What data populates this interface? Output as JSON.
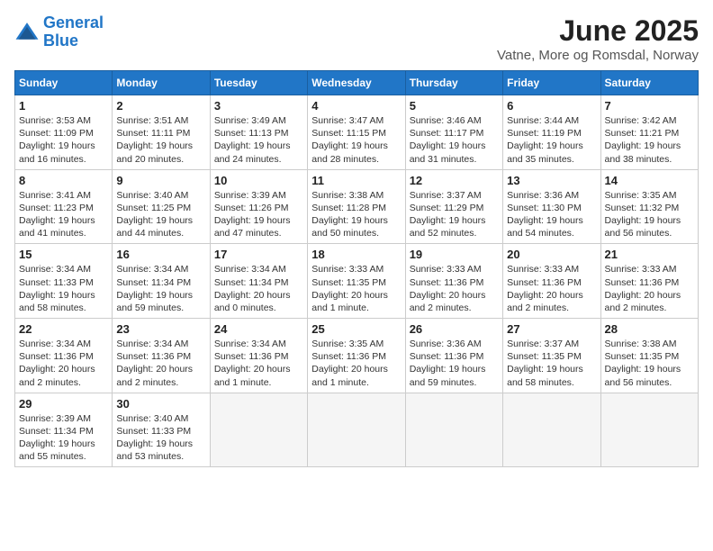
{
  "header": {
    "logo_line1": "General",
    "logo_line2": "Blue",
    "month_title": "June 2025",
    "location": "Vatne, More og Romsdal, Norway"
  },
  "weekdays": [
    "Sunday",
    "Monday",
    "Tuesday",
    "Wednesday",
    "Thursday",
    "Friday",
    "Saturday"
  ],
  "weeks": [
    [
      {
        "day": "1",
        "sunrise": "3:53 AM",
        "sunset": "11:09 PM",
        "daylight": "19 hours and 16 minutes."
      },
      {
        "day": "2",
        "sunrise": "3:51 AM",
        "sunset": "11:11 PM",
        "daylight": "19 hours and 20 minutes."
      },
      {
        "day": "3",
        "sunrise": "3:49 AM",
        "sunset": "11:13 PM",
        "daylight": "19 hours and 24 minutes."
      },
      {
        "day": "4",
        "sunrise": "3:47 AM",
        "sunset": "11:15 PM",
        "daylight": "19 hours and 28 minutes."
      },
      {
        "day": "5",
        "sunrise": "3:46 AM",
        "sunset": "11:17 PM",
        "daylight": "19 hours and 31 minutes."
      },
      {
        "day": "6",
        "sunrise": "3:44 AM",
        "sunset": "11:19 PM",
        "daylight": "19 hours and 35 minutes."
      },
      {
        "day": "7",
        "sunrise": "3:42 AM",
        "sunset": "11:21 PM",
        "daylight": "19 hours and 38 minutes."
      }
    ],
    [
      {
        "day": "8",
        "sunrise": "3:41 AM",
        "sunset": "11:23 PM",
        "daylight": "19 hours and 41 minutes."
      },
      {
        "day": "9",
        "sunrise": "3:40 AM",
        "sunset": "11:25 PM",
        "daylight": "19 hours and 44 minutes."
      },
      {
        "day": "10",
        "sunrise": "3:39 AM",
        "sunset": "11:26 PM",
        "daylight": "19 hours and 47 minutes."
      },
      {
        "day": "11",
        "sunrise": "3:38 AM",
        "sunset": "11:28 PM",
        "daylight": "19 hours and 50 minutes."
      },
      {
        "day": "12",
        "sunrise": "3:37 AM",
        "sunset": "11:29 PM",
        "daylight": "19 hours and 52 minutes."
      },
      {
        "day": "13",
        "sunrise": "3:36 AM",
        "sunset": "11:30 PM",
        "daylight": "19 hours and 54 minutes."
      },
      {
        "day": "14",
        "sunrise": "3:35 AM",
        "sunset": "11:32 PM",
        "daylight": "19 hours and 56 minutes."
      }
    ],
    [
      {
        "day": "15",
        "sunrise": "3:34 AM",
        "sunset": "11:33 PM",
        "daylight": "19 hours and 58 minutes."
      },
      {
        "day": "16",
        "sunrise": "3:34 AM",
        "sunset": "11:34 PM",
        "daylight": "19 hours and 59 minutes."
      },
      {
        "day": "17",
        "sunrise": "3:34 AM",
        "sunset": "11:34 PM",
        "daylight": "20 hours and 0 minutes."
      },
      {
        "day": "18",
        "sunrise": "3:33 AM",
        "sunset": "11:35 PM",
        "daylight": "20 hours and 1 minute."
      },
      {
        "day": "19",
        "sunrise": "3:33 AM",
        "sunset": "11:36 PM",
        "daylight": "20 hours and 2 minutes."
      },
      {
        "day": "20",
        "sunrise": "3:33 AM",
        "sunset": "11:36 PM",
        "daylight": "20 hours and 2 minutes."
      },
      {
        "day": "21",
        "sunrise": "3:33 AM",
        "sunset": "11:36 PM",
        "daylight": "20 hours and 2 minutes."
      }
    ],
    [
      {
        "day": "22",
        "sunrise": "3:34 AM",
        "sunset": "11:36 PM",
        "daylight": "20 hours and 2 minutes."
      },
      {
        "day": "23",
        "sunrise": "3:34 AM",
        "sunset": "11:36 PM",
        "daylight": "20 hours and 2 minutes."
      },
      {
        "day": "24",
        "sunrise": "3:34 AM",
        "sunset": "11:36 PM",
        "daylight": "20 hours and 1 minute."
      },
      {
        "day": "25",
        "sunrise": "3:35 AM",
        "sunset": "11:36 PM",
        "daylight": "20 hours and 1 minute."
      },
      {
        "day": "26",
        "sunrise": "3:36 AM",
        "sunset": "11:36 PM",
        "daylight": "19 hours and 59 minutes."
      },
      {
        "day": "27",
        "sunrise": "3:37 AM",
        "sunset": "11:35 PM",
        "daylight": "19 hours and 58 minutes."
      },
      {
        "day": "28",
        "sunrise": "3:38 AM",
        "sunset": "11:35 PM",
        "daylight": "19 hours and 56 minutes."
      }
    ],
    [
      {
        "day": "29",
        "sunrise": "3:39 AM",
        "sunset": "11:34 PM",
        "daylight": "19 hours and 55 minutes."
      },
      {
        "day": "30",
        "sunrise": "3:40 AM",
        "sunset": "11:33 PM",
        "daylight": "19 hours and 53 minutes."
      },
      null,
      null,
      null,
      null,
      null
    ]
  ]
}
